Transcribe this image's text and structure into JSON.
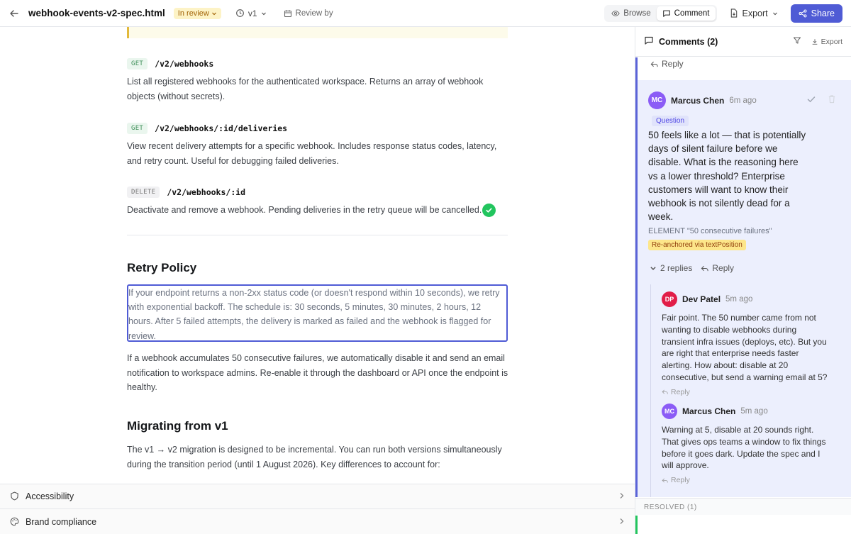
{
  "topbar": {
    "filename": "webhook-events-v2-spec.html",
    "status": "In review",
    "version": "v1",
    "review_by": "Review by",
    "mode_browse": "Browse",
    "mode_comment": "Comment",
    "export": "Export",
    "share": "Share"
  },
  "doc": {
    "endpoints": [
      {
        "method": "GET",
        "path": "/v2/webhooks",
        "desc": "List all registered webhooks for the authenticated workspace. Returns an array of webhook objects (without secrets)."
      },
      {
        "method": "GET",
        "path": "/v2/webhooks/:id/deliveries",
        "desc": "View recent delivery attempts for a specific webhook. Includes response status codes, latency, and retry count. Useful for debugging failed deliveries."
      },
      {
        "method": "DELETE",
        "path": "/v2/webhooks/:id",
        "desc": "Deactivate and remove a webhook. Pending deliveries in the retry queue will be cancelled."
      }
    ],
    "retry_heading": "Retry Policy",
    "retry_selected": "If your endpoint returns a non-2xx status code (or doesn't respond within 10 seconds), we retry with exponential backoff. The schedule is: 30 seconds, 5 minutes, 30 minutes, 2 hours, 12 hours. After 5 failed attempts, the delivery is marked as failed and the webhook is flagged for review.",
    "retry_para2": "If a webhook accumulates 50 consecutive failures, we automatically disable it and send an email notification to workspace admins. Re-enable it through the dashboard or API once the endpoint is healthy.",
    "migrating_heading": "Migrating from v1",
    "migrating_para": "The v1 → v2 migration is designed to be incremental. You can run both versions simultaneously during the transition period (until 1 August 2026). Key differences to account for:"
  },
  "panels": {
    "accessibility": "Accessibility",
    "brand": "Brand compliance"
  },
  "sidebar": {
    "title": "Comments (2)",
    "export": "Export",
    "reply_top": "Reply",
    "main": {
      "initials": "MC",
      "author": "Marcus Chen",
      "time": "6m ago",
      "tag": "Question",
      "body": "50 feels like a lot — that is potentially days of silent failure before we disable. What is the reasoning here vs a lower threshold? Enterprise customers will want to know their webhook is not silently dead for a week.",
      "element_label": "ELEMENT",
      "element_value": "\"50 consecutive failures\"",
      "reanchor": "Re-anchored via textPosition",
      "replies_count": "2 replies",
      "reply": "Reply"
    },
    "replies": [
      {
        "initials": "DP",
        "author": "Dev Patel",
        "time": "5m ago",
        "body": "Fair point. The 50 number came from not wanting to disable webhooks during transient infra issues (deploys, etc). But you are right that enterprise needs faster alerting. How about: disable at 20 consecutive, but send a warning email at 5?",
        "reply": "Reply"
      },
      {
        "initials": "MC",
        "author": "Marcus Chen",
        "time": "5m ago",
        "body": "Warning at 5, disable at 20 sounds right. That gives ops teams a window to fix things before it goes dark. Update the spec and I will approve.",
        "reply": "Reply"
      }
    ],
    "resolved": "RESOLVED (1)"
  }
}
